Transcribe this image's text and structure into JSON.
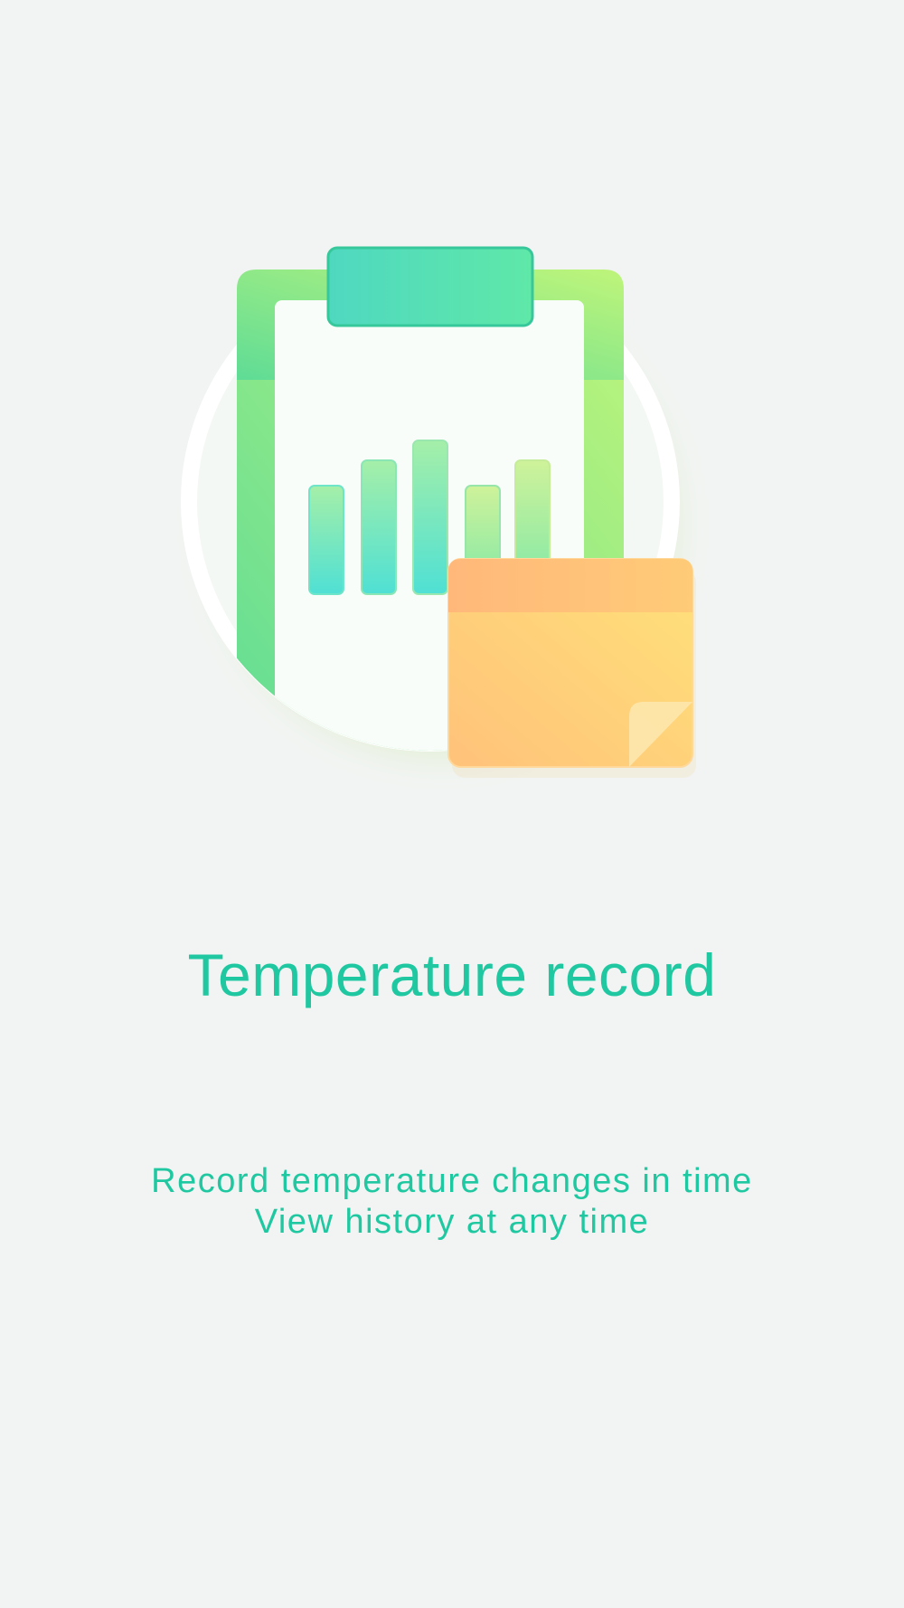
{
  "onboarding": {
    "illustration_icon": "clipboard-chart-with-sticky-note",
    "title": "Temperature record",
    "subtitle_line1": "Record temperature changes in time",
    "subtitle_line2": "View history at any time"
  },
  "colors": {
    "background": "#f2f4f3",
    "accent": "#1fc8a0",
    "clipboard_green": "#7ee07e",
    "sticky_note_orange": "#ffcf6e"
  }
}
